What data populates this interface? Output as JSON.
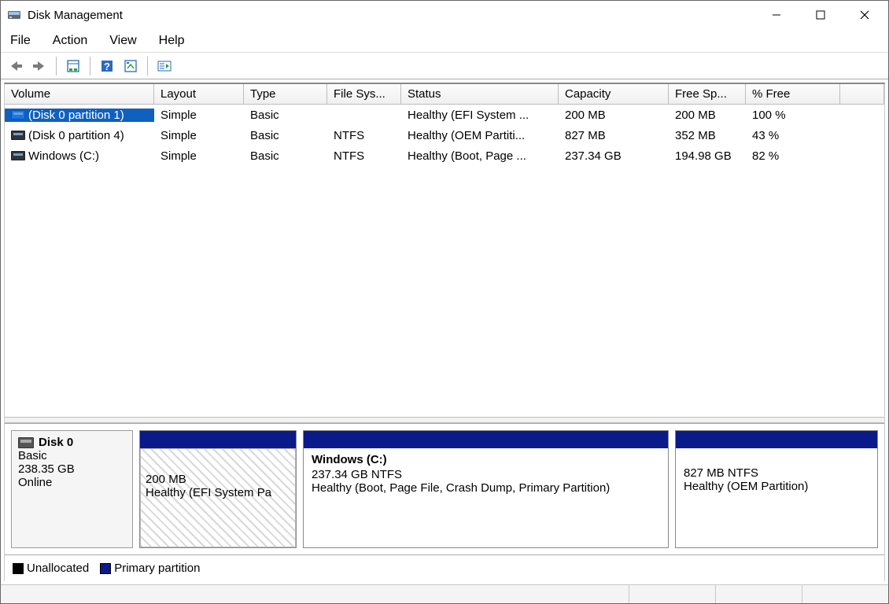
{
  "window": {
    "title": "Disk Management"
  },
  "menu": {
    "file": "File",
    "action": "Action",
    "view": "View",
    "help": "Help"
  },
  "columns": {
    "volume": "Volume",
    "layout": "Layout",
    "type": "Type",
    "filesys": "File Sys...",
    "status": "Status",
    "capacity": "Capacity",
    "free": "Free Sp...",
    "pctfree": "% Free"
  },
  "volumes": [
    {
      "name": "(Disk 0 partition 1)",
      "layout": "Simple",
      "type": "Basic",
      "fs": "",
      "status": "Healthy (EFI System ...",
      "capacity": "200 MB",
      "free": "200 MB",
      "pct": "100 %",
      "selected": true
    },
    {
      "name": "(Disk 0 partition 4)",
      "layout": "Simple",
      "type": "Basic",
      "fs": "NTFS",
      "status": "Healthy (OEM Partiti...",
      "capacity": "827 MB",
      "free": "352 MB",
      "pct": "43 %",
      "selected": false
    },
    {
      "name": "Windows (C:)",
      "layout": "Simple",
      "type": "Basic",
      "fs": "NTFS",
      "status": "Healthy (Boot, Page ...",
      "capacity": "237.34 GB",
      "free": "194.98 GB",
      "pct": "82 %",
      "selected": false
    }
  ],
  "disk": {
    "name": "Disk 0",
    "type": "Basic",
    "size": "238.35 GB",
    "state": "Online",
    "partitions": {
      "efi": {
        "size": "200 MB",
        "status": "Healthy (EFI System Pa"
      },
      "win": {
        "name": "Windows  (C:)",
        "size_fs": "237.34 GB NTFS",
        "status": "Healthy (Boot, Page File, Crash Dump, Primary Partition)"
      },
      "oem": {
        "size_fs": "827 MB NTFS",
        "status": "Healthy (OEM Partition)"
      }
    }
  },
  "legend": {
    "unallocated": "Unallocated",
    "primary": "Primary partition"
  }
}
